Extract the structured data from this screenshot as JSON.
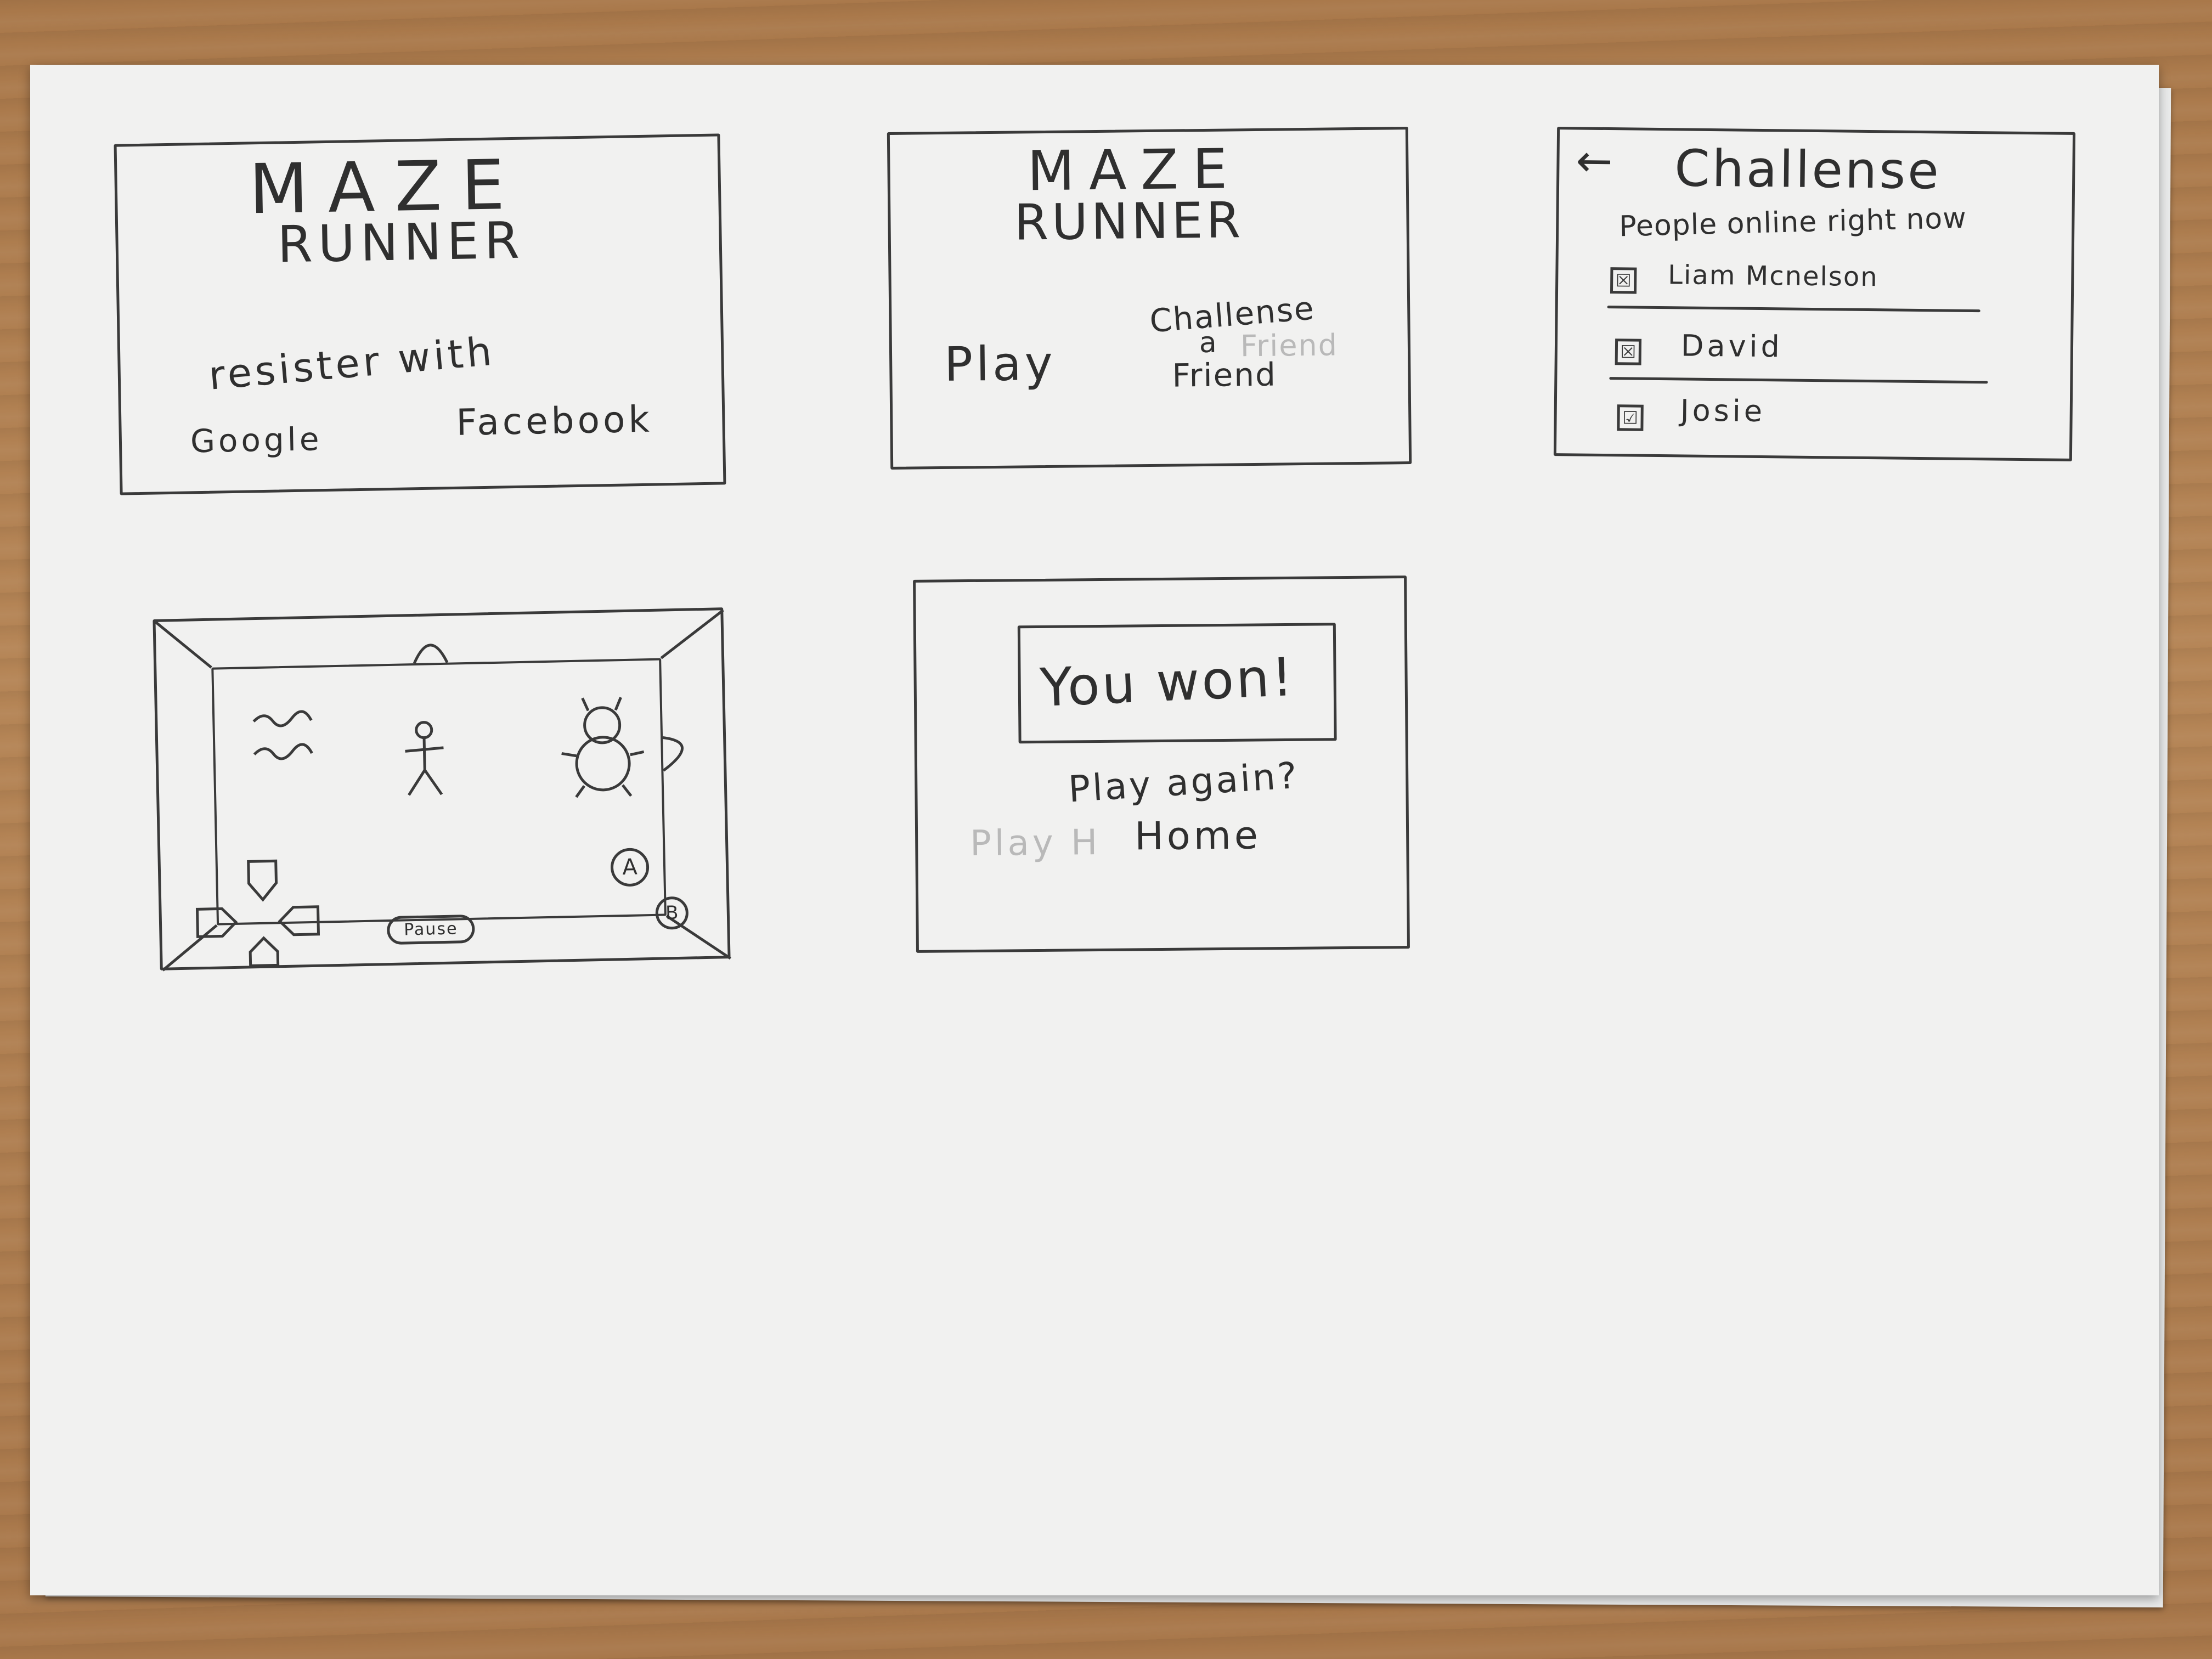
{
  "screens": {
    "login": {
      "title_line1": "MAZE",
      "title_line2": "RUNNER",
      "register_prompt": "resister with",
      "google_label": "Google",
      "facebook_label": "Facebook"
    },
    "home": {
      "title_line1": "MAZE",
      "title_line2": "RUNNER",
      "play_label": "Play",
      "challenge_line1": "Challense",
      "challenge_line2": "a",
      "challenge_line3": "Friend",
      "faint_text": "Friend"
    },
    "challenge": {
      "back_arrow": "←",
      "title": "Challense",
      "subtitle": "People online right now",
      "people": [
        {
          "name": "Liam Mcnelson",
          "check": "☒"
        },
        {
          "name": "David",
          "check": "☒"
        },
        {
          "name": "Josie",
          "check": "☑"
        }
      ]
    },
    "game": {
      "pause_label": "Pause",
      "button_a": "A",
      "button_b": "B"
    },
    "result": {
      "message": "You won!",
      "play_again_label": "Play again?",
      "home_label": "Home",
      "faint_text": "Play H"
    }
  },
  "colors": {
    "pencil": "#2f2f2f",
    "paper": "#f1f1f0",
    "table": "#b08050"
  }
}
